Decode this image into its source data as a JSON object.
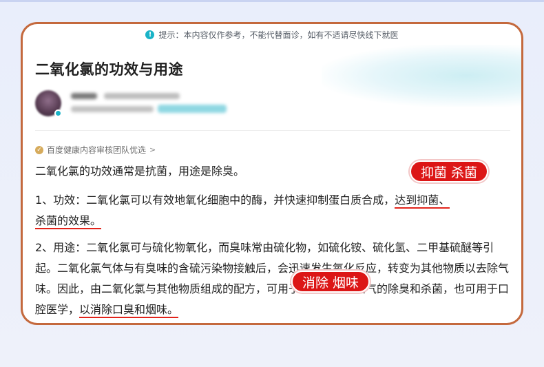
{
  "notice": {
    "text": "提示：本内容仅作参考，不能代替面诊，如有不适请尽快线下就医",
    "icon": "info-icon"
  },
  "article": {
    "title": "二氧化氯的功效与用途"
  },
  "audit": {
    "text": "百度健康内容审核团队优选",
    "icon": "shield-check-icon"
  },
  "content": {
    "intro": "二氧化氯的功效通常是抗菌，用途是除臭。",
    "effect_prefix": "1、功效：二氧化氯可以有效地氧化细胞中的酶，并快速抑制蛋白质合成，",
    "effect_highlight_a": "达到抑菌、",
    "effect_highlight_b": "杀菌的效果。",
    "use_text": "2、用途：二氧化氯可与硫化物氧化，而臭味常由硫化物，如硫化铵、硫化氢、二甲基硫醚等引起。二氧化氯气体与有臭味的含硫污染物接触后，会迅速发生氧化反应，转变为其他物质以去除气味。因此，由二氧化氯与其他物质组成的配方，可用于冰箱和室内空气的除臭和杀菌，也可用于口腔医学，",
    "use_highlight": "以消除口臭和烟味。"
  },
  "tags": {
    "tag1": "抑菌 杀菌",
    "tag2": "消除 烟味"
  },
  "colors": {
    "frame": "#c4693d",
    "tag_red": "#dc1616",
    "underline": "#e2231a",
    "accent": "#19b3c7"
  }
}
